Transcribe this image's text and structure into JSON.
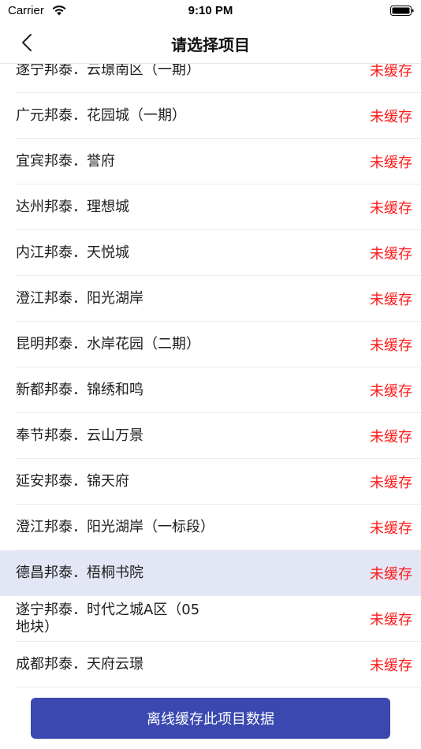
{
  "status_bar": {
    "carrier": "Carrier",
    "time": "9:10 PM"
  },
  "nav": {
    "title": "请选择项目"
  },
  "colors": {
    "status_text": "#ff1a1a",
    "button_bg": "#3a48b0",
    "selected_row_bg": "#e3e6f4"
  },
  "projects": [
    {
      "name": "遂宁邦泰．云璟南区（一期）",
      "status": "未缓存",
      "selected": false
    },
    {
      "name": "广元邦泰．花园城（一期）",
      "status": "未缓存",
      "selected": false
    },
    {
      "name": "宜宾邦泰．誉府",
      "status": "未缓存",
      "selected": false
    },
    {
      "name": "达州邦泰．理想城",
      "status": "未缓存",
      "selected": false
    },
    {
      "name": "内江邦泰．天悦城",
      "status": "未缓存",
      "selected": false
    },
    {
      "name": "澄江邦泰．阳光湖岸",
      "status": "未缓存",
      "selected": false
    },
    {
      "name": "昆明邦泰．水岸花园（二期）",
      "status": "未缓存",
      "selected": false
    },
    {
      "name": "新都邦泰．锦绣和鸣",
      "status": "未缓存",
      "selected": false
    },
    {
      "name": "奉节邦泰．云山万景",
      "status": "未缓存",
      "selected": false
    },
    {
      "name": "延安邦泰．锦天府",
      "status": "未缓存",
      "selected": false
    },
    {
      "name": "澄江邦泰．阳光湖岸（一标段）",
      "status": "未缓存",
      "selected": false
    },
    {
      "name": "德昌邦泰．梧桐书院",
      "status": "未缓存",
      "selected": true
    },
    {
      "name": "遂宁邦泰．时代之城A区（05\n地块）",
      "status": "未缓存",
      "selected": false
    },
    {
      "name": "成都邦泰．天府云璟",
      "status": "未缓存",
      "selected": false
    }
  ],
  "bottom": {
    "button_label": "离线缓存此项目数据"
  }
}
